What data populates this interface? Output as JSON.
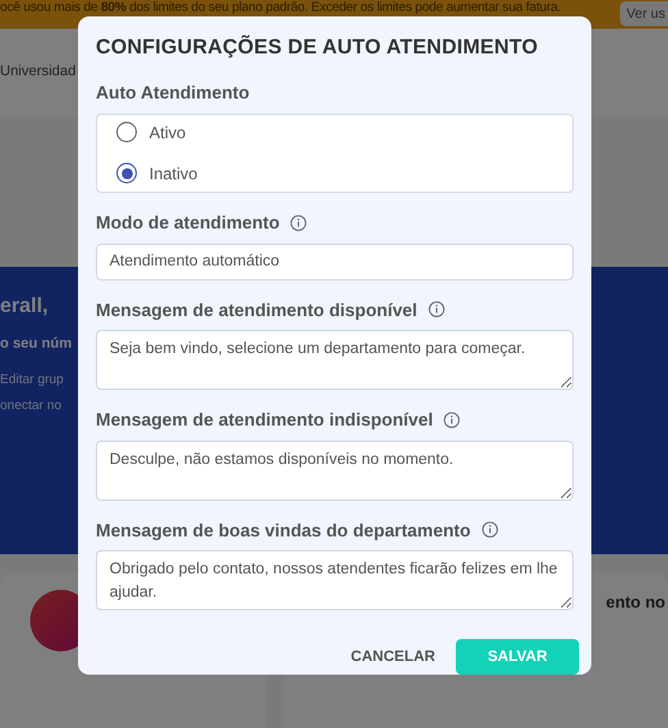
{
  "banner": {
    "text": "ocê usou mais de **80%** dos limites do seu plano padrão. Exceder os limites pode aumentar sua fatura.",
    "button": "Ver us"
  },
  "header": {
    "link": "Universidad"
  },
  "hero": {
    "title": "erall,",
    "subtitle": "o seu núm",
    "lines": [
      "Editar grup",
      "onectar no"
    ]
  },
  "cards": {
    "right_title": "ento no"
  },
  "dialog": {
    "title": "CONFIGURAÇÕES DE AUTO ATENDIMENTO",
    "auto": {
      "label": "Auto Atendimento",
      "options": [
        {
          "label": "Ativo",
          "selected": false
        },
        {
          "label": "Inativo",
          "selected": true
        }
      ]
    },
    "fields": [
      {
        "kind": "input",
        "label": "Modo de atendimento",
        "info_icon": true,
        "value": "Atendimento automático"
      },
      {
        "kind": "textarea",
        "label": "Mensagem de atendimento disponível",
        "info_icon": true,
        "value": "Seja bem vindo, selecione um departamento para começar."
      },
      {
        "kind": "textarea",
        "label": "Mensagem de atendimento indisponível",
        "info_icon": true,
        "value": "Desculpe, não estamos disponíveis no momento."
      },
      {
        "kind": "textarea",
        "label": "Mensagem de boas vindas do departamento",
        "info_icon": true,
        "value": "Obrigado pelo contato, nossos atendentes ficarão felizes em lhe ajudar."
      }
    ],
    "buttons": {
      "cancel": "CANCELAR",
      "save": "SALVAR"
    }
  }
}
